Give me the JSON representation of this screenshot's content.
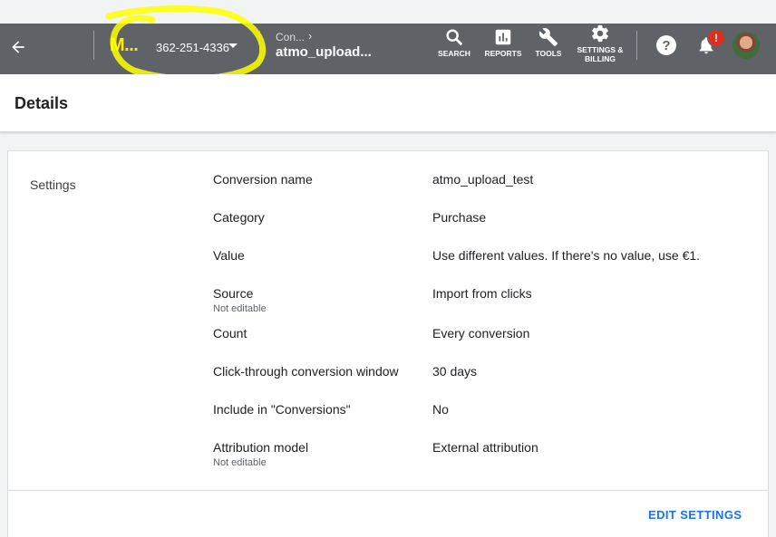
{
  "topbar": {
    "account_name": "M...",
    "account_id": "362-251-4336",
    "breadcrumb_parent": "Con...",
    "breadcrumb_current": "atmo_upload...",
    "tools": [
      {
        "label": "SEARCH",
        "icon": "search-icon"
      },
      {
        "label": "REPORTS",
        "icon": "reports-icon"
      },
      {
        "label": "TOOLS",
        "icon": "wrench-icon"
      },
      {
        "label": "SETTINGS & BILLING",
        "icon": "gear-icon"
      }
    ],
    "notification_badge": "!"
  },
  "page": {
    "title": "Details"
  },
  "settings": {
    "section_label": "Settings",
    "rows": [
      {
        "label": "Conversion name",
        "sub": "",
        "value": "atmo_upload_test"
      },
      {
        "label": "Category",
        "sub": "",
        "value": "Purchase"
      },
      {
        "label": "Value",
        "sub": "",
        "value": "Use different values. If there's no value, use €1."
      },
      {
        "label": "Source",
        "sub": "Not editable",
        "value": "Import from clicks"
      },
      {
        "label": "Count",
        "sub": "",
        "value": "Every conversion"
      },
      {
        "label": "Click-through conversion window",
        "sub": "",
        "value": "30 days"
      },
      {
        "label": "Include in \"Conversions\"",
        "sub": "",
        "value": "No"
      },
      {
        "label": "Attribution model",
        "sub": "Not editable",
        "value": "External attribution"
      }
    ],
    "edit_button": "EDIT SETTINGS"
  },
  "colors": {
    "topbar": "#5f6368",
    "accent": "#1a73e8",
    "annotation": "#ffff00",
    "badge": "#d93025"
  }
}
